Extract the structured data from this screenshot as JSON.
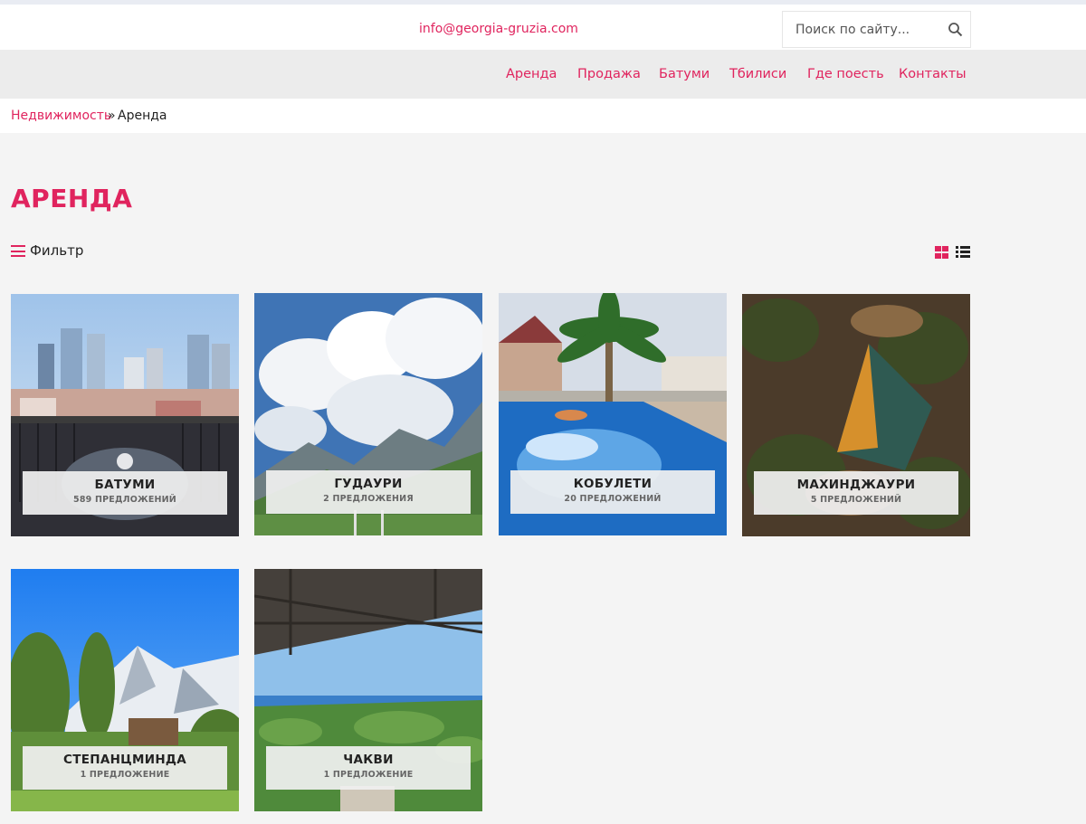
{
  "header": {
    "email": "info@georgia-gruzia.com",
    "search_placeholder": "Поиск по сайту..."
  },
  "nav": {
    "items": [
      {
        "label": "Аренда"
      },
      {
        "label": "Продажа"
      },
      {
        "label": "Батуми"
      },
      {
        "label": "Тбилиси"
      },
      {
        "label": "Где поесть"
      },
      {
        "label": "Контакты"
      }
    ]
  },
  "breadcrumb": {
    "parent": "Недвижимость",
    "separator": "»",
    "current": "Аренда"
  },
  "page": {
    "title": "АРЕНДА",
    "filter_label": "Фильтр"
  },
  "accent_color": "#e0245e",
  "cards": [
    {
      "name": "БАТУМИ",
      "count": "589 ПРЕДЛОЖЕНИЙ"
    },
    {
      "name": "ГУДАУРИ",
      "count": "2 ПРЕДЛОЖЕНИЯ"
    },
    {
      "name": "КОБУЛЕТИ",
      "count": "20 ПРЕДЛОЖЕНИЙ"
    },
    {
      "name": "МАХИНДЖАУРИ",
      "count": "5 ПРЕДЛОЖЕНИЙ"
    },
    {
      "name": "СТЕПАНЦМИНДА",
      "count": "1 ПРЕДЛОЖЕНИЕ"
    },
    {
      "name": "ЧАКВИ",
      "count": "1 ПРЕДЛОЖЕНИЕ"
    }
  ]
}
